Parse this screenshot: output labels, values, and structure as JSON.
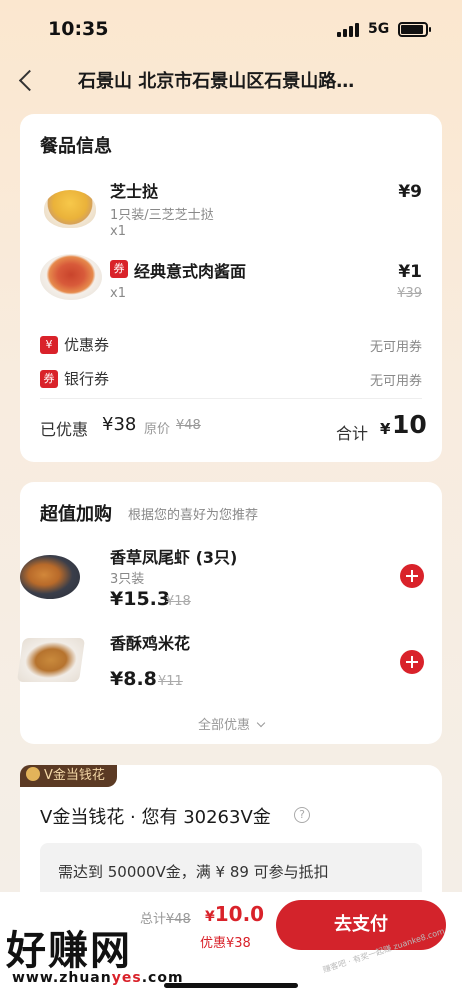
{
  "status": {
    "time": "10:35",
    "network": "5G"
  },
  "nav": {
    "title": "石景山 北京市石景山区石景山路…"
  },
  "order": {
    "title": "餐品信息",
    "items": [
      {
        "name": "芝士挞",
        "sub": "1只装/三芝芝士挞",
        "qty": "x1",
        "price": "¥9"
      },
      {
        "tag": "券",
        "name": "经典意式肉酱面",
        "qty": "x1",
        "price": "¥1",
        "original": "¥39"
      }
    ],
    "coupon": {
      "tag": "¥",
      "label": "优惠券",
      "value": "无可用券"
    },
    "bank": {
      "tag": "券",
      "label": "银行券",
      "value": "无可用券"
    },
    "saved_label": "已优惠",
    "saved_amount": "¥38",
    "original_label": "原价",
    "original_amount": "¥48",
    "total_label": "合计",
    "total_yen": "¥",
    "total_value": "10"
  },
  "addon": {
    "title": "超值加购",
    "subtitle": "根据您的喜好为您推荐",
    "items": [
      {
        "name": "香草凤尾虾 (3只)",
        "sub": "3只装",
        "price": "¥15.3",
        "original": "¥18"
      },
      {
        "name": "香酥鸡米花",
        "price": "¥8.8",
        "original": "¥11"
      }
    ],
    "more": "全部优惠"
  },
  "vgold": {
    "badge": "V金当钱花",
    "title": "V金当钱花 · 您有 30263V金",
    "help": "?",
    "note": "需达到 50000V金，满 ¥ 89 可参与抵扣"
  },
  "bottom": {
    "total_prefix": "总计",
    "total_original": "¥48",
    "final_yen": "¥",
    "final_value": "10.0",
    "discount": "优惠¥38",
    "pay": "去支付"
  },
  "watermark": {
    "big": "好赚网",
    "url_pre": "www.zhuan",
    "url_hl": "yes",
    "url_post": ".com",
    "small": "赚客吧 · 有奖一起赚 zuanke8.com"
  },
  "colors": {
    "accent": "#d9222a",
    "bg_top": "#fbe7cf"
  }
}
